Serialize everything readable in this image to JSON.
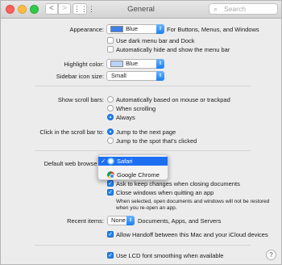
{
  "window": {
    "title": "General"
  },
  "toolbar": {
    "back_glyph": "<",
    "forward_glyph": ">",
    "grid_glyph": "⋮⋮⋮",
    "search_placeholder": "Search"
  },
  "appearance": {
    "label": "Appearance:",
    "value": "Blue",
    "suffix": "For Buttons, Menus, and Windows",
    "swatch_color": "#3d7fe8",
    "dark_menu": "Use dark menu bar and Dock",
    "auto_hide": "Automatically hide and show the menu bar"
  },
  "highlight": {
    "label": "Highlight color:",
    "value": "Blue",
    "swatch_color": "#b7d3f7"
  },
  "sidebar_icon": {
    "label": "Sidebar icon size:",
    "value": "Small"
  },
  "scroll_bars": {
    "label": "Show scroll bars:",
    "options": [
      "Automatically based on mouse or trackpad",
      "When scrolling",
      "Always"
    ],
    "selected": "Always"
  },
  "click_scroll": {
    "label": "Click in the scroll bar to:",
    "options": [
      "Jump to the next page",
      "Jump to the spot that’s clicked"
    ],
    "selected": "Jump to the next page"
  },
  "browser": {
    "label": "Default web browser",
    "menu_items": [
      "Safari",
      "Google Chrome"
    ],
    "selected": "Safari"
  },
  "documents": {
    "ask_keep": "Ask to keep changes when closing documents",
    "close_windows": "Close windows when quitting an app",
    "note_line1": "When selected, open documents and windows will not be restored",
    "note_line2": "when you re-open an app."
  },
  "recent": {
    "label": "Recent items:",
    "value": "None",
    "suffix": "Documents, Apps, and Servers"
  },
  "handoff": "Allow Handoff between this Mac and your iCloud devices",
  "lcd": "Use LCD font smoothing when available",
  "help_glyph": "?"
}
